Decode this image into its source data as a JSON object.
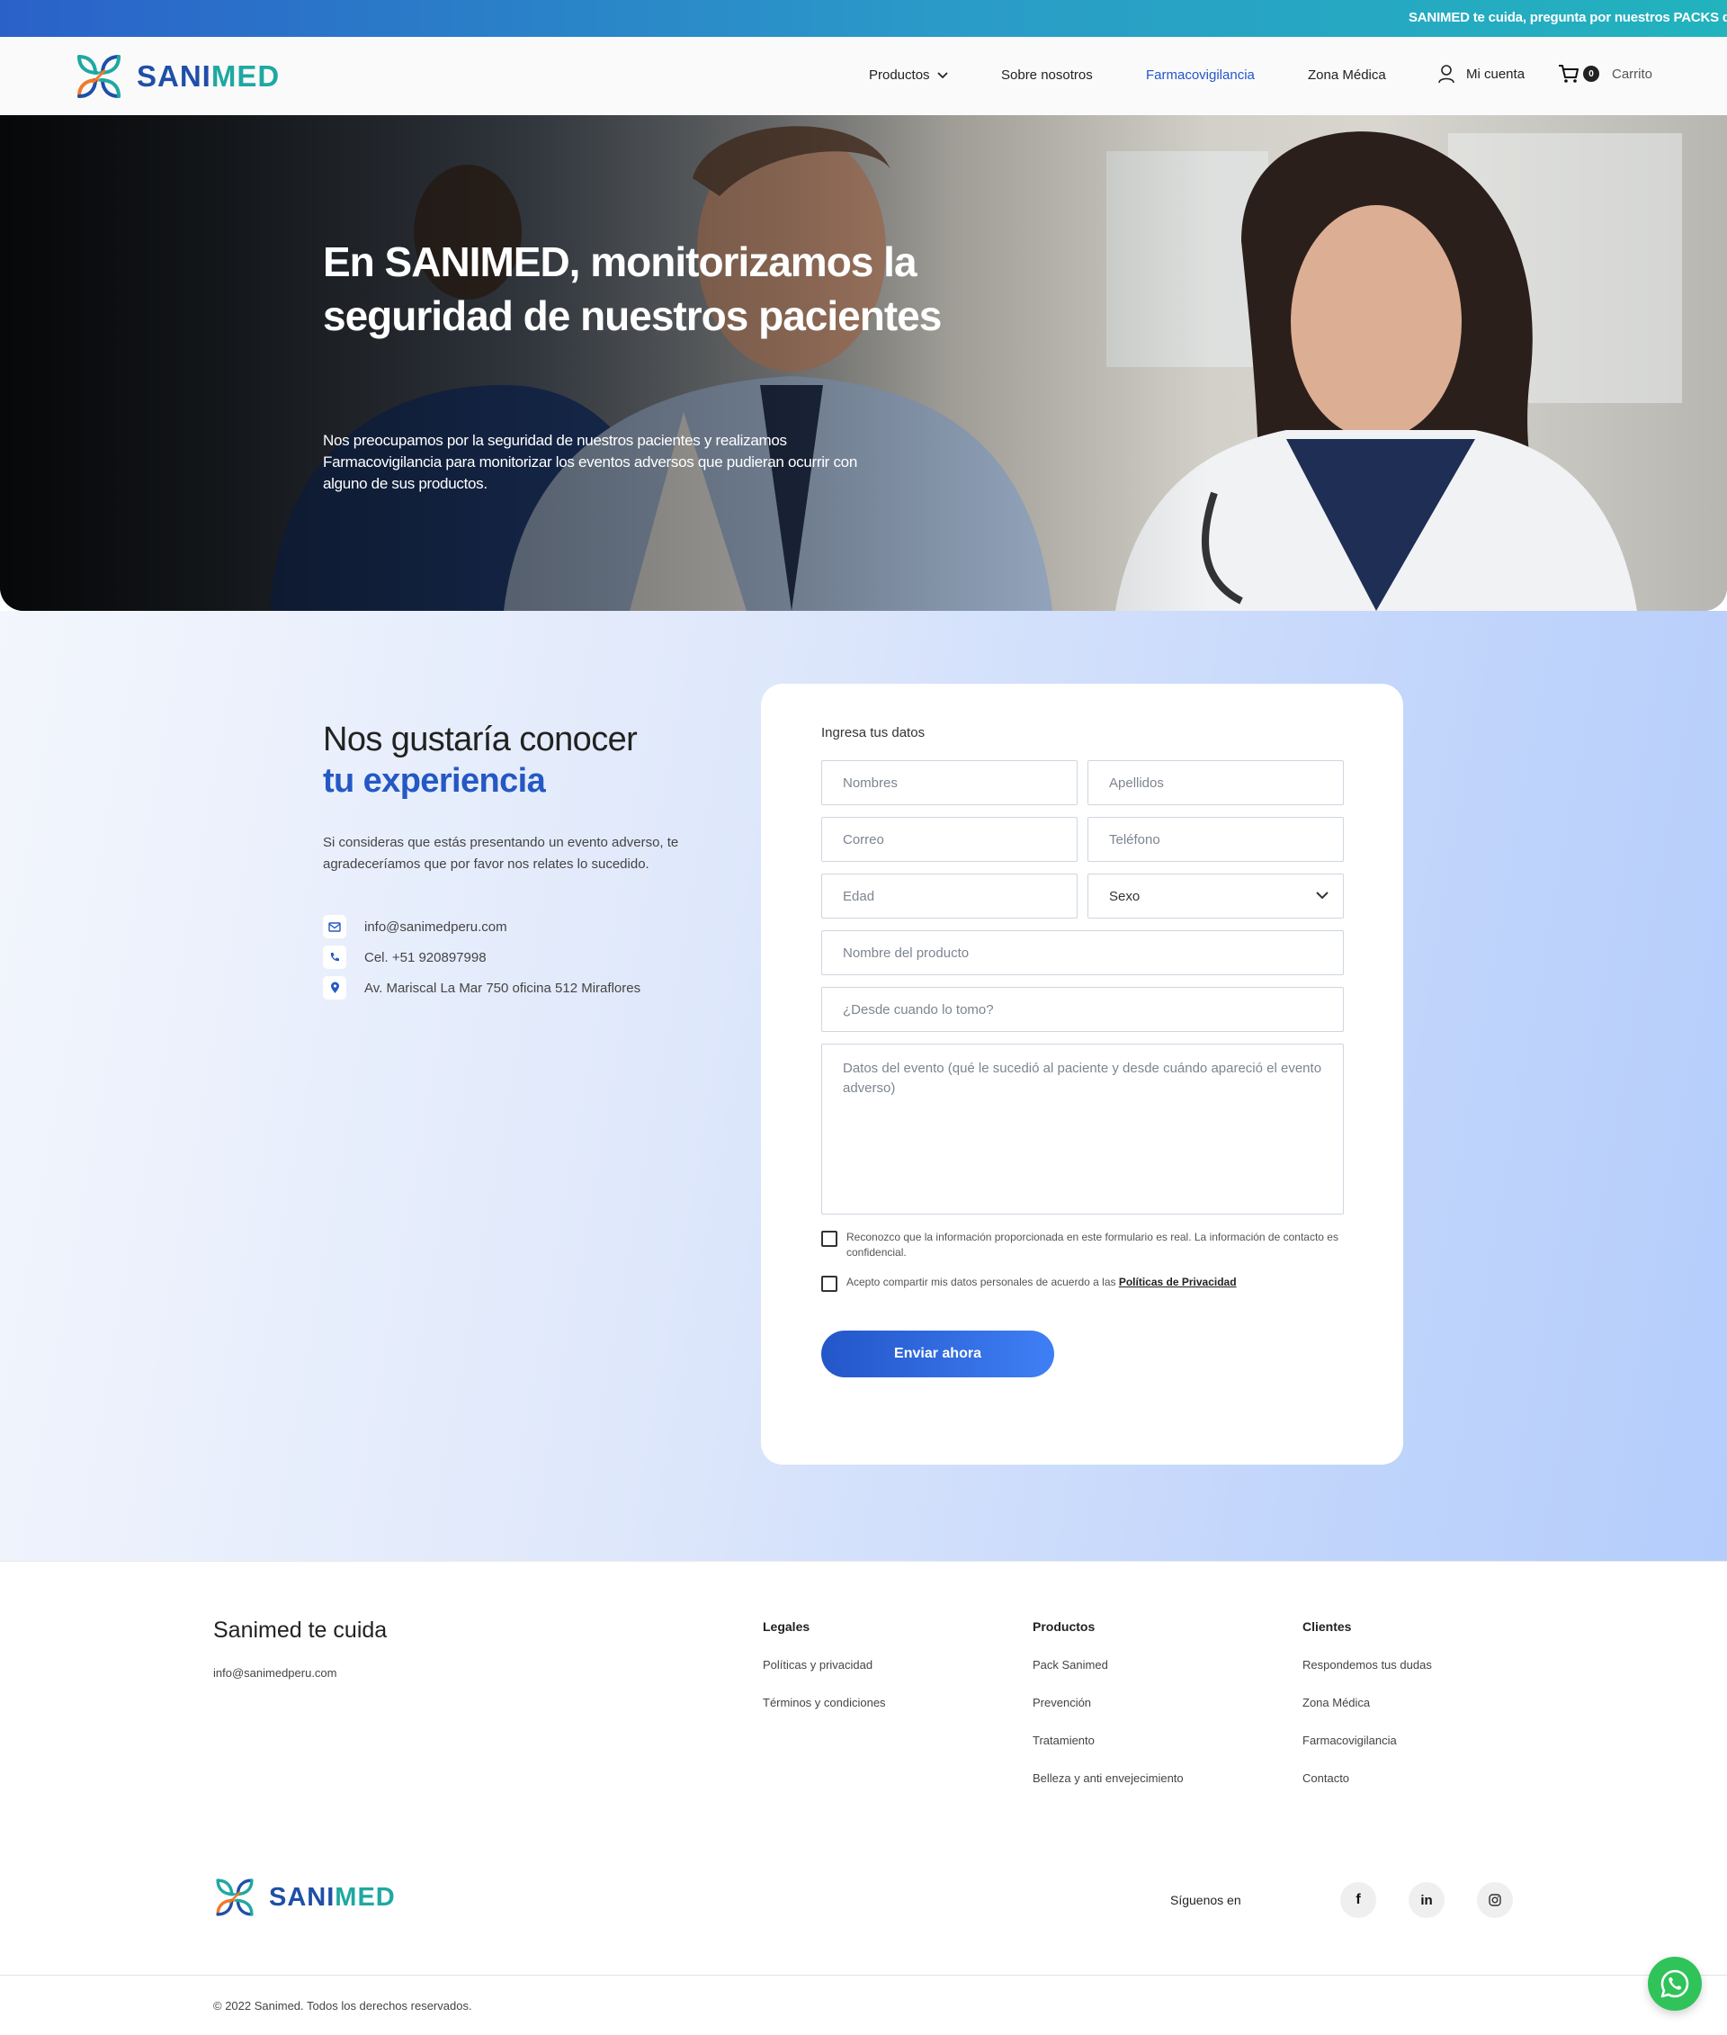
{
  "promo": {
    "text": "SANIMED te cuida, pregunta por nuestros PACKS de"
  },
  "brand": {
    "name_part1": "SANI",
    "name_part2": "MED",
    "primary_color": "#1f4fa8",
    "accent_color": "#1fa8a2"
  },
  "nav": {
    "products": "Productos",
    "about": "Sobre nosotros",
    "pharmacovigilance": "Farmacovigilancia",
    "medical_zone": "Zona Médica",
    "account": "Mi cuenta",
    "cart_count": "0",
    "cart": "Carrito"
  },
  "hero": {
    "title": "En SANIMED, monitorizamos la seguridad de nuestros pacientes",
    "subtitle": "Nos preocupamos por la seguridad de nuestros pacientes y realizamos Farmacovigilancia para monitorizar los eventos adversos que pudieran ocurrir con alguno de sus productos."
  },
  "experience": {
    "title_line1": "Nos gustaría conocer",
    "title_line2": "tu experiencia",
    "description": "Si consideras que estás presentando un evento adverso, te agradeceríamos que por favor nos relates lo sucedido.",
    "email": "info@sanimedperu.com",
    "phone": "Cel. +51 920897998",
    "address": "Av. Mariscal La Mar 750 oficina 512 Miraflores"
  },
  "form": {
    "label": "Ingresa tus datos",
    "first_name": "Nombres",
    "last_name": "Apellidos",
    "email": "Correo",
    "phone": "Teléfono",
    "age": "Edad",
    "sex": "Sexo",
    "product_name": "Nombre del producto",
    "since_when": "¿Desde cuando lo tomo?",
    "event_details": "Datos del evento (qué le sucedió al paciente y desde cuándo apareció el evento adverso)",
    "consent_truth": "Reconozco que la información proporcionada en este formulario es real. La información de contacto es confidencial.",
    "consent_privacy_prefix": "Acepto compartir mis datos personales de acuerdo a las ",
    "consent_privacy_link": "Políticas de Privacidad",
    "submit": "Enviar ahora"
  },
  "footer": {
    "title": "Sanimed te cuida",
    "email": "info@sanimedperu.com",
    "legal_head": "Legales",
    "legal_links": [
      "Políticas y privacidad",
      "Términos y condiciones"
    ],
    "products_head": "Productos",
    "products_links": [
      "Pack Sanimed",
      "Prevención",
      "Tratamiento",
      "Belleza y anti envejecimiento"
    ],
    "clients_head": "Clientes",
    "clients_links": [
      "Respondemos tus dudas",
      "Zona Médica",
      "Farmacovigilancia",
      "Contacto"
    ],
    "follow": "Síguenos en",
    "copyright": "© 2022 Sanimed. Todos los derechos reservados."
  },
  "icons": [
    "logo-icon",
    "chevron-down-icon",
    "user-icon",
    "cart-icon",
    "mail-icon",
    "phone-icon",
    "location-icon",
    "facebook-icon",
    "linkedin-icon",
    "instagram-icon",
    "whatsapp-icon"
  ]
}
